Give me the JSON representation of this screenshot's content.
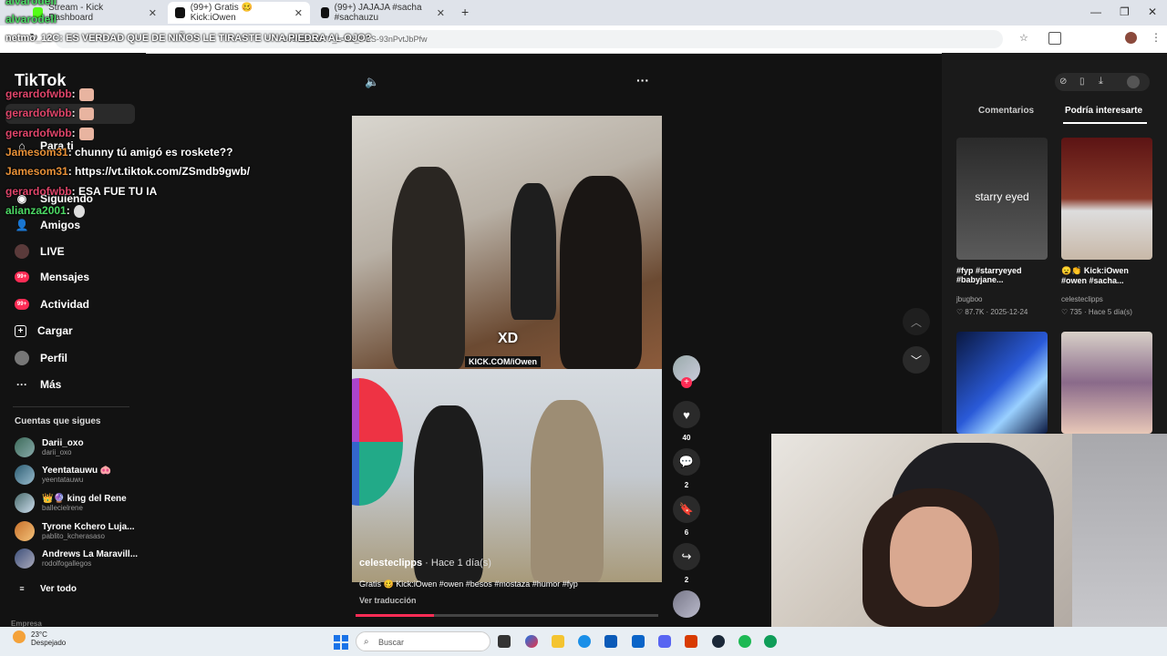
{
  "browser": {
    "tabs": [
      {
        "label": "Stream - Kick Dashboard",
        "active": false
      },
      {
        "label": "(99+) Gratis 🥴 Kick:iOwen",
        "active": true
      },
      {
        "label": "(99+) JAJAJA #sacha #sachauzu",
        "active": false
      }
    ],
    "new_tab": "+",
    "url": "2494651107?_r=1&_t=ZS-93nPvtJbPfw",
    "window_controls": {
      "minimize": "—",
      "maximize": "❐",
      "close": "✕"
    }
  },
  "chat": {
    "messages": [
      {
        "user": "alvarodell",
        "text": "",
        "color": "green"
      },
      {
        "user": "alvarodell",
        "text": "",
        "color": "green"
      },
      {
        "user": "netmo_12C",
        "text": ": ES VERDAD QUE DE NIÑOS LE TIRASTE UNA PIEDRA AL OJO?",
        "color": "white"
      },
      {
        "user": "gerardofwbb",
        "text": ":",
        "color": "pink"
      },
      {
        "user": "gerardofwbb",
        "text": ":",
        "color": "pink"
      },
      {
        "user": "gerardofwbb",
        "text": ":",
        "color": "pink"
      },
      {
        "user": "Jamesom31",
        "text": ": chunny tú amigó es roskete??",
        "color": "orange"
      },
      {
        "user": "Jamesom31",
        "text": ": https://vt.tiktok.com/ZSmdb9gwb/",
        "color": "orange"
      },
      {
        "user": "gerardofwbb",
        "text": ": ESA FUE TU IA",
        "color": "pink"
      },
      {
        "user": "alianza2001",
        "text": ":",
        "color": "green"
      }
    ]
  },
  "tiktok": {
    "logo": "TikTok",
    "nav": [
      {
        "label": "Para ti",
        "icon": "home-icon"
      },
      {
        "label": "Siguiendo",
        "icon": "following-icon"
      },
      {
        "label": "Amigos",
        "icon": "friends-icon"
      },
      {
        "label": "LIVE",
        "icon": "live-icon"
      },
      {
        "label": "Mensajes",
        "icon": "messages-icon",
        "badge": "99+"
      },
      {
        "label": "Actividad",
        "icon": "activity-icon",
        "badge": "99+"
      },
      {
        "label": "Cargar",
        "icon": "upload-icon"
      },
      {
        "label": "Perfil",
        "icon": "profile-icon"
      },
      {
        "label": "Más",
        "icon": "more-icon"
      }
    ],
    "following_title": "Cuentas que sigues",
    "following": [
      {
        "name": "Darii_oxo",
        "handle": "darii_oxo"
      },
      {
        "name": "Yeentatauwu 🐽",
        "handle": "yeentatauwu"
      },
      {
        "name": "👑🔮 king del Rene",
        "handle": "ballecielrene"
      },
      {
        "name": "Tyrone Kchero Luja...",
        "handle": "pablito_kcherasaso"
      },
      {
        "name": "Andrews La Maravill...",
        "handle": "rodolfogallegos"
      }
    ],
    "see_all": "Ver todo",
    "footer_label": "Empresa",
    "video": {
      "overlay_text": "XD",
      "watermark": "KICK.COM/iOwen",
      "creator": "celesteclipps",
      "date": "· Hace 1 día(s)",
      "description": "Gratis 🥴 Kick:iOwen #owen #besos #mostaza #humor #fyp",
      "translate": "Ver traducción",
      "progress": 0.26
    },
    "actions": {
      "like_count": "40",
      "comment_count": "2",
      "save_count": "6",
      "share_count": "2"
    },
    "right_panel": {
      "tabs": [
        "Comentarios",
        "Podría interesarte"
      ],
      "active_tab": 1,
      "videos": [
        {
          "caption": "#fyp #starryeyed #babyjane...",
          "author": "jbugboo",
          "likes": "87.7K",
          "date": "2025-12-24",
          "overlay": "starry eyed"
        },
        {
          "caption": "😦👏 Kick:iOwen #owen #sacha...",
          "author": "celesteclipps",
          "likes": "735",
          "date": "Hace 5 día(s)",
          "overlay": ""
        }
      ]
    }
  },
  "taskbar": {
    "weather_temp": "23°C",
    "weather_desc": "Despejado",
    "search_placeholder": "Buscar"
  },
  "colors": {
    "tiktok_red": "#fe2c55",
    "chat_pink": "#e0456a",
    "chat_orange": "#e89138",
    "chat_green": "#4cd964"
  }
}
